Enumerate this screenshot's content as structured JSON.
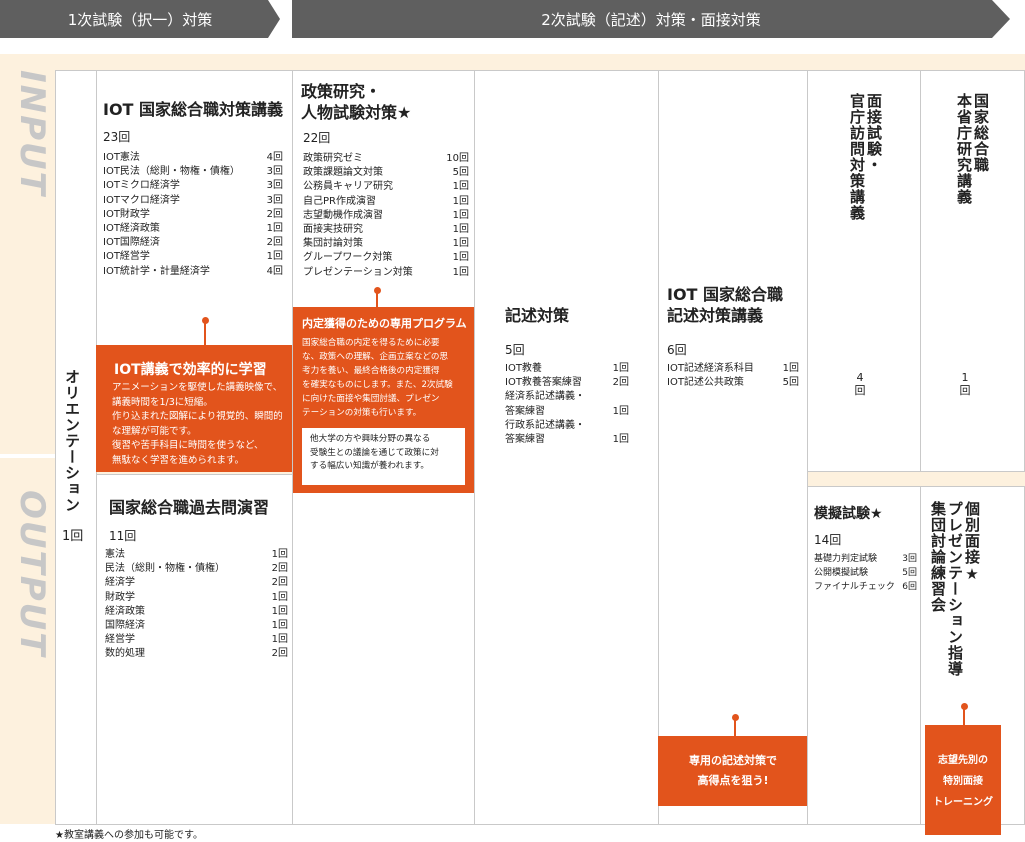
{
  "header": {
    "stage1": "1次試験（択一）対策",
    "stage2": "2次試験（記述）対策・面接対策"
  },
  "side": {
    "input": "INPUT",
    "output": "OUTPUT"
  },
  "orientation": {
    "label": "オリエンテーション",
    "count": "1回"
  },
  "iot_course": {
    "title": "IOT 国家総合職対策講義",
    "count": "23回",
    "items": [
      {
        "name": "IOT憲法",
        "count": "4回"
      },
      {
        "name": "IOT民法（総則・物権・債権）",
        "count": "3回"
      },
      {
        "name": "IOTミクロ経済学",
        "count": "3回"
      },
      {
        "name": "IOTマクロ経済学",
        "count": "3回"
      },
      {
        "name": "IOT財政学",
        "count": "2回"
      },
      {
        "name": "IOT経済政策",
        "count": "1回"
      },
      {
        "name": "IOT国際経済",
        "count": "2回"
      },
      {
        "name": "IOT経営学",
        "count": "1回"
      },
      {
        "name": "IOT統計学・計量経済学",
        "count": "4回"
      }
    ],
    "callout_title": "IOT講義で効率的に学習",
    "callout_lines": [
      "アニメーションを駆使した講義映像で、",
      "講義時間を1/3に短縮。",
      "作り込まれた図解により視覚的、瞬間的",
      "な理解が可能です。",
      "復習や苦手科目に時間を使うなど、",
      "無駄なく学習を進められます。"
    ]
  },
  "past_exam": {
    "title": "国家総合職過去問演習",
    "count": "11回",
    "items": [
      {
        "name": "憲法",
        "count": "1回"
      },
      {
        "name": "民法（総則・物権・債権）",
        "count": "2回"
      },
      {
        "name": "経済学",
        "count": "2回"
      },
      {
        "name": "財政学",
        "count": "1回"
      },
      {
        "name": "経済政策",
        "count": "1回"
      },
      {
        "name": "国際経済",
        "count": "1回"
      },
      {
        "name": "経営学",
        "count": "1回"
      },
      {
        "name": "数的処理",
        "count": "2回"
      }
    ]
  },
  "policy": {
    "title_line1": "政策研究・",
    "title_line2": "人物試験対策★",
    "count": "22回",
    "items": [
      {
        "name": "政策研究ゼミ",
        "count": "10回"
      },
      {
        "name": "政策課題論文対策",
        "count": "5回"
      },
      {
        "name": "公務員キャリア研究",
        "count": "1回"
      },
      {
        "name": "自己PR作成演習",
        "count": "1回"
      },
      {
        "name": "志望動機作成演習",
        "count": "1回"
      },
      {
        "name": "面接実技研究",
        "count": "1回"
      },
      {
        "name": "集団討論対策",
        "count": "1回"
      },
      {
        "name": "グループワーク対策",
        "count": "1回"
      },
      {
        "name": "プレゼンテーション対策",
        "count": "1回"
      }
    ],
    "callout_title": "内定獲得のための専用プログラム",
    "callout_lines": [
      "国家総合職の内定を得るために必要",
      "な、政策への理解、企画立案などの思",
      "考力を養い、最終合格後の内定獲得",
      "を確実なものにします。また、2次試験",
      "に向けた面接や集団討議、プレゼン",
      "テーションの対策も行います。"
    ],
    "note_lines": [
      "他大学の方や興味分野の異なる",
      "受験生との議論を通じて政策に対",
      "する幅広い知識が養われます。"
    ]
  },
  "essay": {
    "title": "記述対策",
    "count": "5回",
    "items": [
      {
        "name": "IOT教養",
        "count": "1回"
      },
      {
        "name": "IOT教養答案練習",
        "count": "2回"
      },
      {
        "name": "経済系記述講義・",
        "count": ""
      },
      {
        "name": "答案練習",
        "count": "1回"
      },
      {
        "name": "行政系記述講義・",
        "count": ""
      },
      {
        "name": "答案練習",
        "count": "1回"
      }
    ]
  },
  "iot_essay": {
    "title_line1": "IOT 国家総合職",
    "title_line2": "記述対策講義",
    "count": "6回",
    "items": [
      {
        "name": "IOT記述経済系科目",
        "count": "1回"
      },
      {
        "name": "IOT記述公共政策",
        "count": "5回"
      }
    ],
    "callout_line1": "専用の記述対策で",
    "callout_line2": "高得点を狙う!"
  },
  "interview_research": {
    "title_line1": "面接試験・",
    "title_line2": "官庁訪問対策講義",
    "count": "4回"
  },
  "ministry": {
    "title_line1": "国家総合職",
    "title_line2": "本省庁研究講義",
    "count": "1回"
  },
  "mock": {
    "title": "模擬試験★",
    "count": "14回",
    "items": [
      {
        "name": "基礎力判定試験",
        "count": "3回"
      },
      {
        "name": "公開模擬試験",
        "count": "5回"
      },
      {
        "name": "ファイナルチェック",
        "count": "6回"
      }
    ]
  },
  "individual": {
    "title_line1": "個別面接★",
    "title_line2": "プレゼンテーション指導",
    "title_line3": "集団討論練習会",
    "callout_lines": [
      "志望先別の",
      "特別面接",
      "トレーニング"
    ]
  },
  "footnote": "★教室講義への参加も可能です。"
}
